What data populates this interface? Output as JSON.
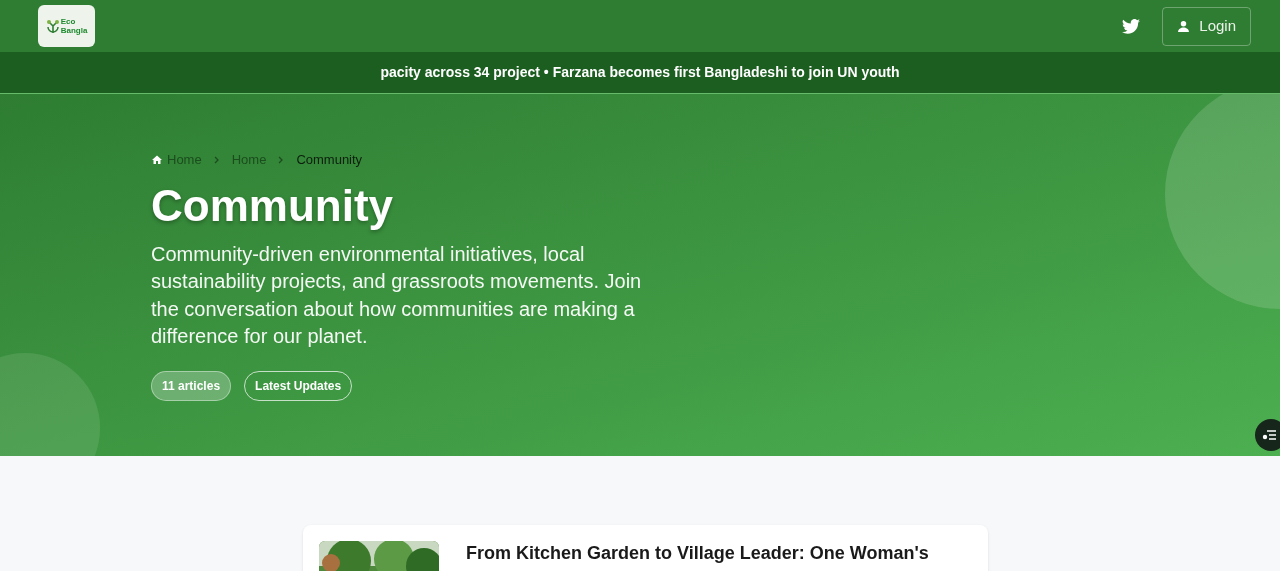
{
  "header": {
    "logo": {
      "line_1": "Eco",
      "line_2": "Bangla"
    },
    "login_button": "Login"
  },
  "ticker": {
    "text": "pacity across 34 project • Farzana becomes first Bangladeshi to join UN youth"
  },
  "hero": {
    "breadcrumbs": [
      {
        "label": "Home",
        "kind": "home"
      },
      {
        "label": "Home",
        "kind": "link"
      },
      {
        "label": "Community",
        "kind": "current"
      }
    ],
    "title": "Community",
    "description": "Community-driven environmental initiatives, local sustainability projects, and grassroots movements. Join the conversation about how communities are making a difference for our planet.",
    "chips": [
      {
        "label": "11 articles",
        "kind": "filled"
      },
      {
        "label": "Latest Updates",
        "kind": "outline"
      }
    ]
  },
  "articles": [
    {
      "title": "From Kitchen Garden to Village Leader: One Woman's"
    }
  ]
}
